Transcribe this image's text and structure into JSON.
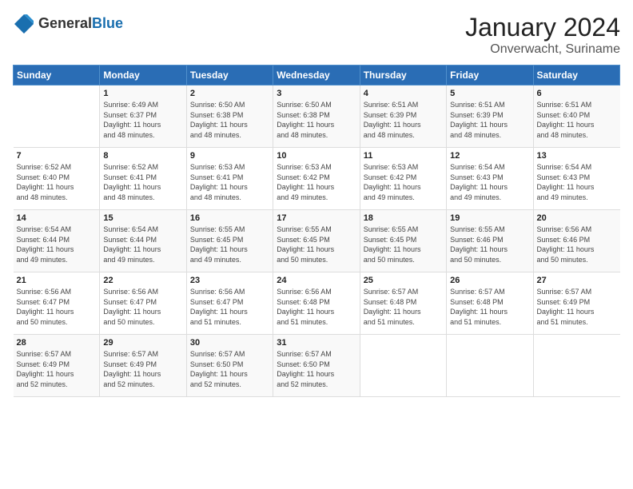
{
  "header": {
    "logo_general": "General",
    "logo_blue": "Blue",
    "title": "January 2024",
    "subtitle": "Onverwacht, Suriname"
  },
  "columns": [
    "Sunday",
    "Monday",
    "Tuesday",
    "Wednesday",
    "Thursday",
    "Friday",
    "Saturday"
  ],
  "weeks": [
    [
      {
        "day": "",
        "info": ""
      },
      {
        "day": "1",
        "info": "Sunrise: 6:49 AM\nSunset: 6:37 PM\nDaylight: 11 hours\nand 48 minutes."
      },
      {
        "day": "2",
        "info": "Sunrise: 6:50 AM\nSunset: 6:38 PM\nDaylight: 11 hours\nand 48 minutes."
      },
      {
        "day": "3",
        "info": "Sunrise: 6:50 AM\nSunset: 6:38 PM\nDaylight: 11 hours\nand 48 minutes."
      },
      {
        "day": "4",
        "info": "Sunrise: 6:51 AM\nSunset: 6:39 PM\nDaylight: 11 hours\nand 48 minutes."
      },
      {
        "day": "5",
        "info": "Sunrise: 6:51 AM\nSunset: 6:39 PM\nDaylight: 11 hours\nand 48 minutes."
      },
      {
        "day": "6",
        "info": "Sunrise: 6:51 AM\nSunset: 6:40 PM\nDaylight: 11 hours\nand 48 minutes."
      }
    ],
    [
      {
        "day": "7",
        "info": "Sunrise: 6:52 AM\nSunset: 6:40 PM\nDaylight: 11 hours\nand 48 minutes."
      },
      {
        "day": "8",
        "info": "Sunrise: 6:52 AM\nSunset: 6:41 PM\nDaylight: 11 hours\nand 48 minutes."
      },
      {
        "day": "9",
        "info": "Sunrise: 6:53 AM\nSunset: 6:41 PM\nDaylight: 11 hours\nand 48 minutes."
      },
      {
        "day": "10",
        "info": "Sunrise: 6:53 AM\nSunset: 6:42 PM\nDaylight: 11 hours\nand 49 minutes."
      },
      {
        "day": "11",
        "info": "Sunrise: 6:53 AM\nSunset: 6:42 PM\nDaylight: 11 hours\nand 49 minutes."
      },
      {
        "day": "12",
        "info": "Sunrise: 6:54 AM\nSunset: 6:43 PM\nDaylight: 11 hours\nand 49 minutes."
      },
      {
        "day": "13",
        "info": "Sunrise: 6:54 AM\nSunset: 6:43 PM\nDaylight: 11 hours\nand 49 minutes."
      }
    ],
    [
      {
        "day": "14",
        "info": "Sunrise: 6:54 AM\nSunset: 6:44 PM\nDaylight: 11 hours\nand 49 minutes."
      },
      {
        "day": "15",
        "info": "Sunrise: 6:54 AM\nSunset: 6:44 PM\nDaylight: 11 hours\nand 49 minutes."
      },
      {
        "day": "16",
        "info": "Sunrise: 6:55 AM\nSunset: 6:45 PM\nDaylight: 11 hours\nand 49 minutes."
      },
      {
        "day": "17",
        "info": "Sunrise: 6:55 AM\nSunset: 6:45 PM\nDaylight: 11 hours\nand 50 minutes."
      },
      {
        "day": "18",
        "info": "Sunrise: 6:55 AM\nSunset: 6:45 PM\nDaylight: 11 hours\nand 50 minutes."
      },
      {
        "day": "19",
        "info": "Sunrise: 6:55 AM\nSunset: 6:46 PM\nDaylight: 11 hours\nand 50 minutes."
      },
      {
        "day": "20",
        "info": "Sunrise: 6:56 AM\nSunset: 6:46 PM\nDaylight: 11 hours\nand 50 minutes."
      }
    ],
    [
      {
        "day": "21",
        "info": "Sunrise: 6:56 AM\nSunset: 6:47 PM\nDaylight: 11 hours\nand 50 minutes."
      },
      {
        "day": "22",
        "info": "Sunrise: 6:56 AM\nSunset: 6:47 PM\nDaylight: 11 hours\nand 50 minutes."
      },
      {
        "day": "23",
        "info": "Sunrise: 6:56 AM\nSunset: 6:47 PM\nDaylight: 11 hours\nand 51 minutes."
      },
      {
        "day": "24",
        "info": "Sunrise: 6:56 AM\nSunset: 6:48 PM\nDaylight: 11 hours\nand 51 minutes."
      },
      {
        "day": "25",
        "info": "Sunrise: 6:57 AM\nSunset: 6:48 PM\nDaylight: 11 hours\nand 51 minutes."
      },
      {
        "day": "26",
        "info": "Sunrise: 6:57 AM\nSunset: 6:48 PM\nDaylight: 11 hours\nand 51 minutes."
      },
      {
        "day": "27",
        "info": "Sunrise: 6:57 AM\nSunset: 6:49 PM\nDaylight: 11 hours\nand 51 minutes."
      }
    ],
    [
      {
        "day": "28",
        "info": "Sunrise: 6:57 AM\nSunset: 6:49 PM\nDaylight: 11 hours\nand 52 minutes."
      },
      {
        "day": "29",
        "info": "Sunrise: 6:57 AM\nSunset: 6:49 PM\nDaylight: 11 hours\nand 52 minutes."
      },
      {
        "day": "30",
        "info": "Sunrise: 6:57 AM\nSunset: 6:50 PM\nDaylight: 11 hours\nand 52 minutes."
      },
      {
        "day": "31",
        "info": "Sunrise: 6:57 AM\nSunset: 6:50 PM\nDaylight: 11 hours\nand 52 minutes."
      },
      {
        "day": "",
        "info": ""
      },
      {
        "day": "",
        "info": ""
      },
      {
        "day": "",
        "info": ""
      }
    ]
  ]
}
